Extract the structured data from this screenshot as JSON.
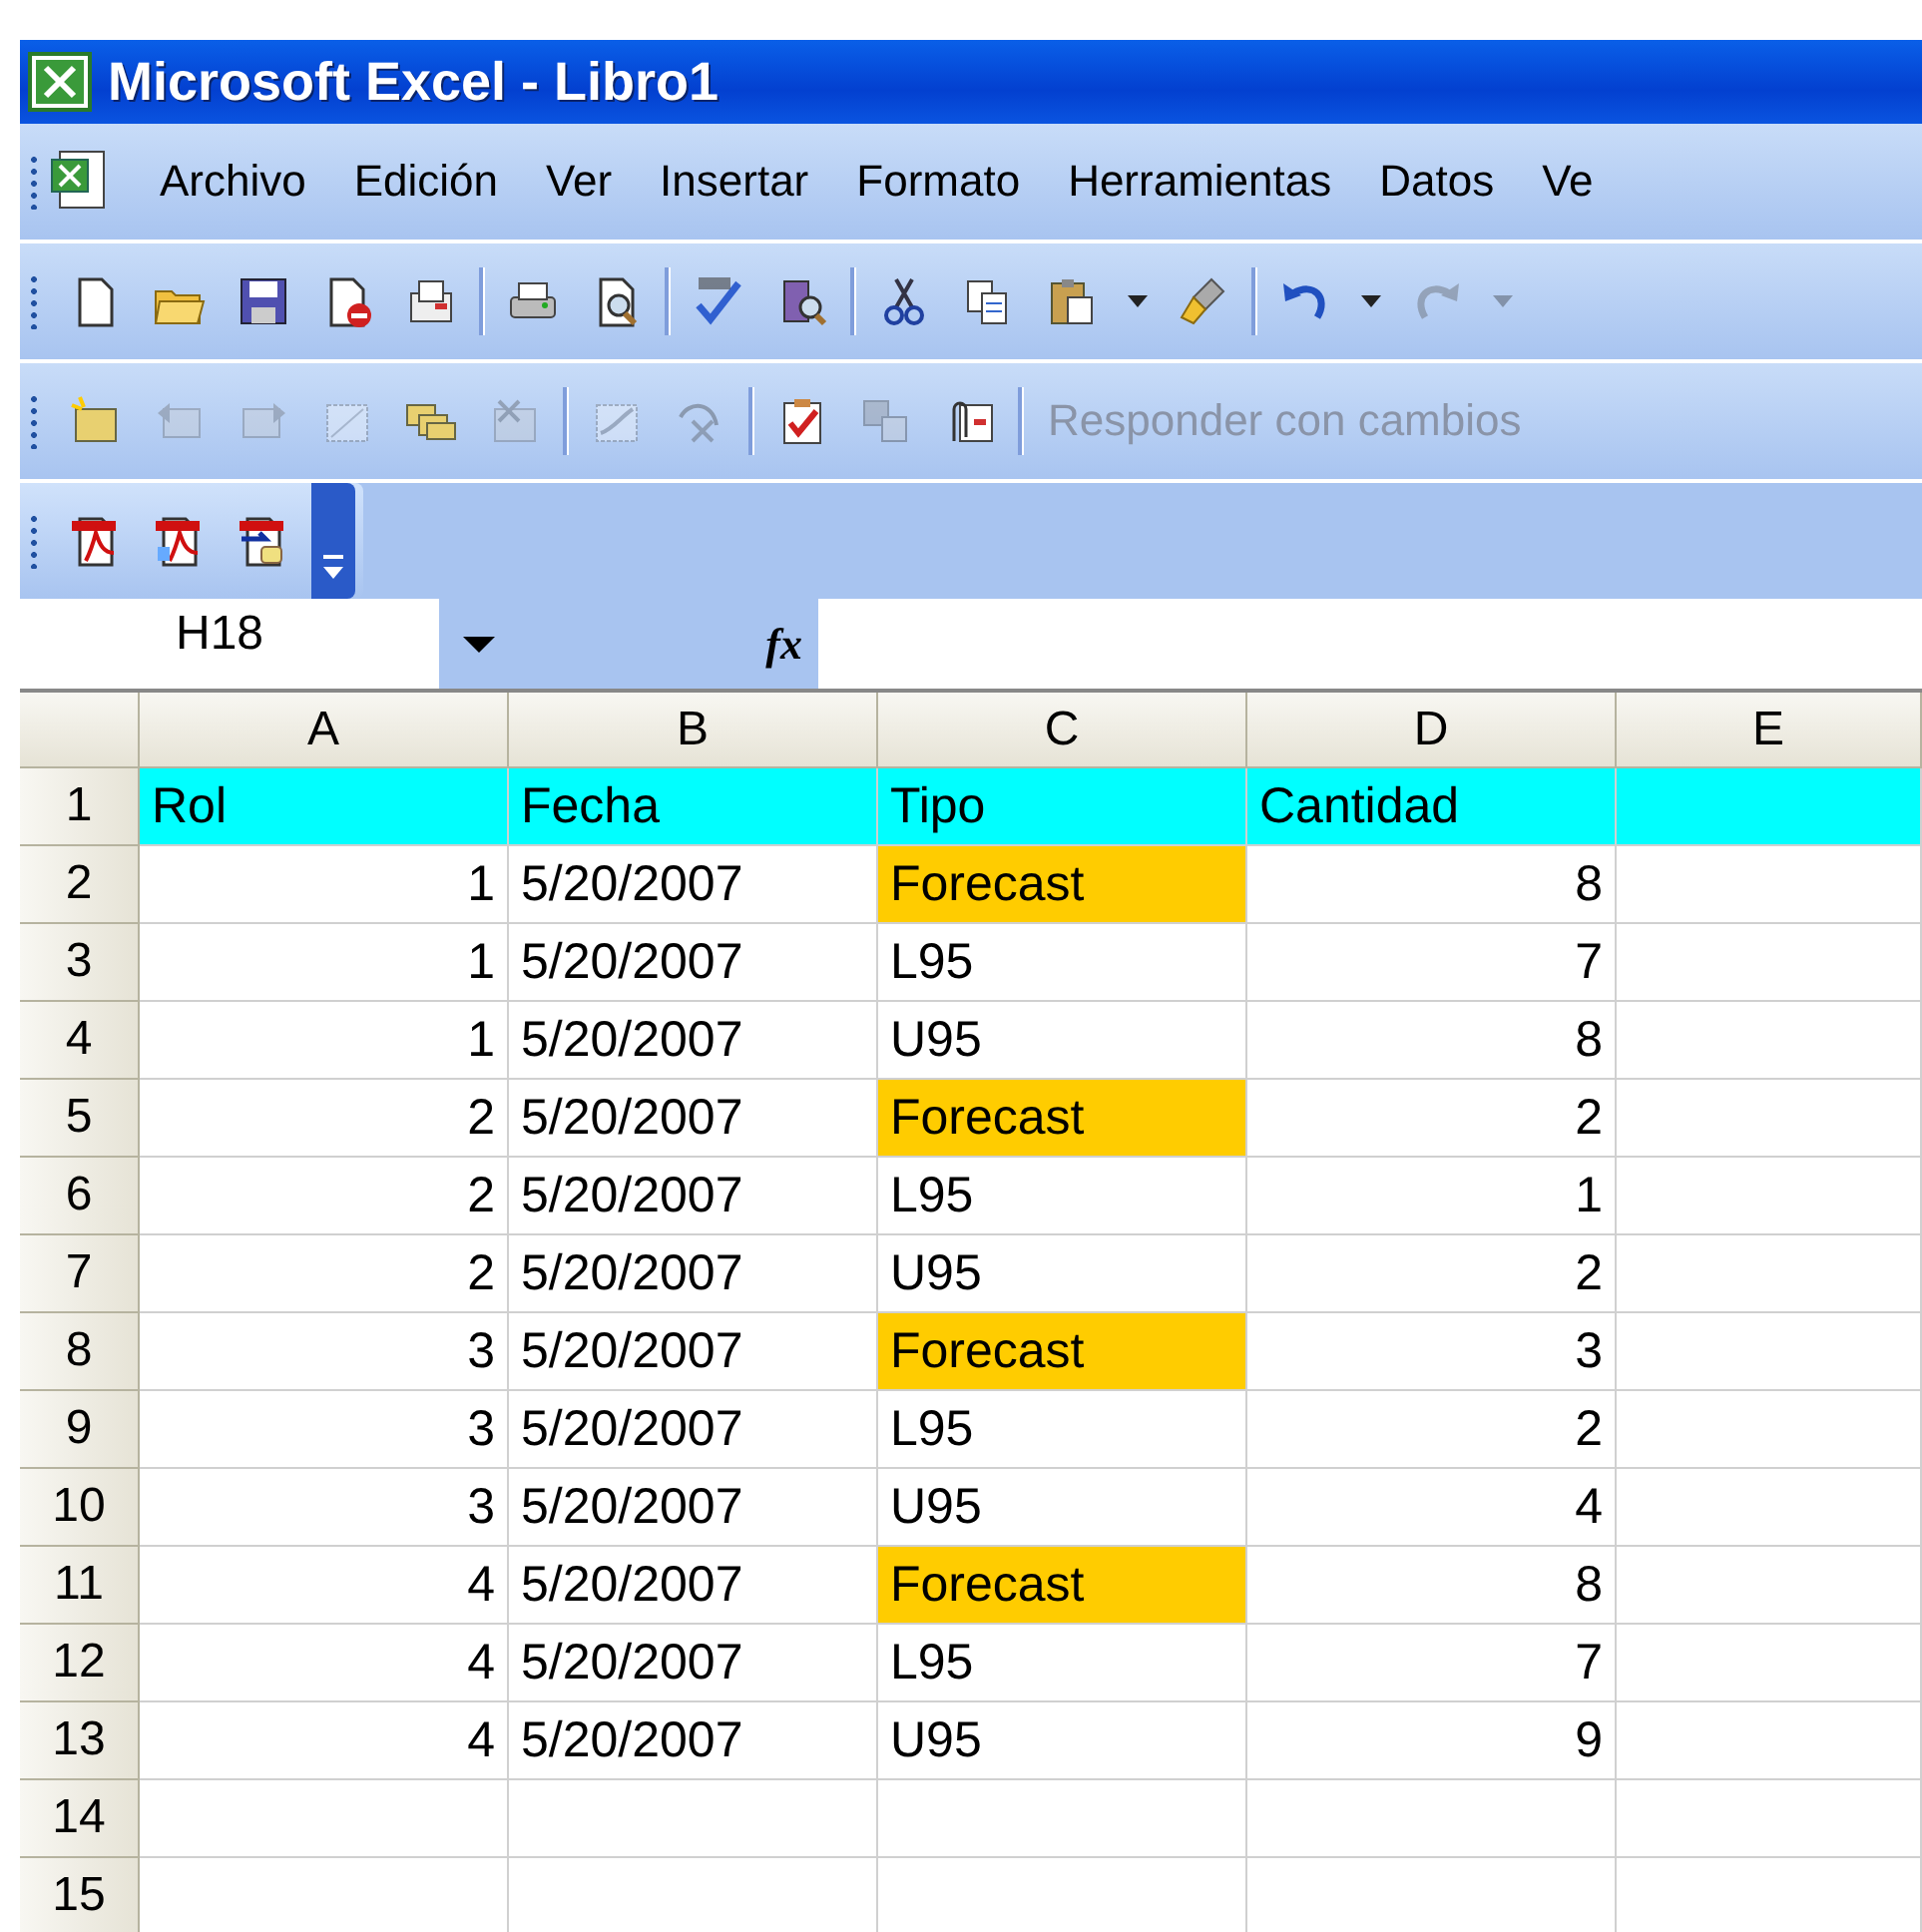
{
  "window": {
    "title": "Microsoft Excel - Libro1"
  },
  "menu": {
    "items": [
      "Archivo",
      "Edición",
      "Ver",
      "Insertar",
      "Formato",
      "Herramientas",
      "Datos",
      "Ve"
    ]
  },
  "toolbars": [
    {
      "items": [
        {
          "kind": "button",
          "disabled": false
        },
        {
          "kind": "button",
          "disabled": false
        },
        {
          "kind": "button",
          "disabled": false
        },
        {
          "kind": "button",
          "disabled": false
        },
        {
          "kind": "button",
          "disabled": false
        },
        {
          "kind": "separator"
        },
        {
          "kind": "button",
          "disabled": false
        },
        {
          "kind": "button",
          "disabled": false
        },
        {
          "kind": "separator"
        },
        {
          "kind": "button",
          "disabled": false
        },
        {
          "kind": "button",
          "disabled": false
        },
        {
          "kind": "separator"
        },
        {
          "kind": "button",
          "disabled": false
        },
        {
          "kind": "button",
          "disabled": false
        },
        {
          "kind": "button",
          "disabled": false
        },
        {
          "kind": "dropdown",
          "disabled": false
        },
        {
          "kind": "button",
          "disabled": false
        },
        {
          "kind": "separator"
        },
        {
          "kind": "button",
          "disabled": false
        },
        {
          "kind": "dropdown",
          "disabled": false
        },
        {
          "kind": "button",
          "disabled": true
        },
        {
          "kind": "dropdown",
          "disabled": true
        }
      ]
    },
    {
      "items": [
        {
          "kind": "button",
          "disabled": false
        },
        {
          "kind": "button",
          "disabled": true
        },
        {
          "kind": "button",
          "disabled": true
        },
        {
          "kind": "button",
          "disabled": true
        },
        {
          "kind": "button",
          "disabled": false
        },
        {
          "kind": "button",
          "disabled": true
        },
        {
          "kind": "separator"
        },
        {
          "kind": "button",
          "disabled": true
        },
        {
          "kind": "button",
          "disabled": true
        },
        {
          "kind": "separator"
        },
        {
          "kind": "button",
          "disabled": false
        },
        {
          "kind": "button",
          "disabled": true
        },
        {
          "kind": "button",
          "disabled": false
        },
        {
          "kind": "separator"
        },
        {
          "kind": "text",
          "label": "Responder con cambios",
          "disabled": true
        }
      ]
    },
    {
      "items": [
        {
          "kind": "button",
          "disabled": false
        },
        {
          "kind": "button",
          "disabled": false
        },
        {
          "kind": "button",
          "disabled": false
        }
      ]
    }
  ],
  "formula_bar": {
    "name_box": "H18",
    "fx": "fx"
  },
  "sheet": {
    "columns": [
      "A",
      "B",
      "C",
      "D",
      "E"
    ],
    "rows": [
      {
        "number": "1",
        "color": "#00ffff",
        "cells": [
          {
            "text": "Rol",
            "kind": "text"
          },
          {
            "text": "Fecha",
            "kind": "text"
          },
          {
            "text": "Tipo",
            "kind": "text"
          },
          {
            "text": "Cantidad",
            "kind": "text"
          }
        ]
      },
      {
        "number": "2",
        "cells": [
          {
            "text": "1",
            "kind": "number"
          },
          {
            "text": "5/20/2007",
            "kind": "text"
          },
          {
            "text": "Forecast",
            "kind": "text",
            "color": "#ffcc00"
          },
          {
            "text": "8",
            "kind": "number"
          }
        ]
      },
      {
        "number": "3",
        "cells": [
          {
            "text": "1",
            "kind": "number"
          },
          {
            "text": "5/20/2007",
            "kind": "text"
          },
          {
            "text": "L95",
            "kind": "text"
          },
          {
            "text": "7",
            "kind": "number"
          }
        ]
      },
      {
        "number": "4",
        "cells": [
          {
            "text": "1",
            "kind": "number"
          },
          {
            "text": "5/20/2007",
            "kind": "text"
          },
          {
            "text": "U95",
            "kind": "text"
          },
          {
            "text": "8",
            "kind": "number"
          }
        ]
      },
      {
        "number": "5",
        "cells": [
          {
            "text": "2",
            "kind": "number"
          },
          {
            "text": "5/20/2007",
            "kind": "text"
          },
          {
            "text": "Forecast",
            "kind": "text",
            "color": "#ffcc00"
          },
          {
            "text": "2",
            "kind": "number"
          }
        ]
      },
      {
        "number": "6",
        "cells": [
          {
            "text": "2",
            "kind": "number"
          },
          {
            "text": "5/20/2007",
            "kind": "text"
          },
          {
            "text": "L95",
            "kind": "text"
          },
          {
            "text": "1",
            "kind": "number"
          }
        ]
      },
      {
        "number": "7",
        "cells": [
          {
            "text": "2",
            "kind": "number"
          },
          {
            "text": "5/20/2007",
            "kind": "text"
          },
          {
            "text": "U95",
            "kind": "text"
          },
          {
            "text": "2",
            "kind": "number"
          }
        ]
      },
      {
        "number": "8",
        "cells": [
          {
            "text": "3",
            "kind": "number"
          },
          {
            "text": "5/20/2007",
            "kind": "text"
          },
          {
            "text": "Forecast",
            "kind": "text",
            "color": "#ffcc00"
          },
          {
            "text": "3",
            "kind": "number"
          }
        ]
      },
      {
        "number": "9",
        "cells": [
          {
            "text": "3",
            "kind": "number"
          },
          {
            "text": "5/20/2007",
            "kind": "text"
          },
          {
            "text": "L95",
            "kind": "text"
          },
          {
            "text": "2",
            "kind": "number"
          }
        ]
      },
      {
        "number": "10",
        "cells": [
          {
            "text": "3",
            "kind": "number"
          },
          {
            "text": "5/20/2007",
            "kind": "text"
          },
          {
            "text": "U95",
            "kind": "text"
          },
          {
            "text": "4",
            "kind": "number"
          }
        ]
      },
      {
        "number": "11",
        "cells": [
          {
            "text": "4",
            "kind": "number"
          },
          {
            "text": "5/20/2007",
            "kind": "text"
          },
          {
            "text": "Forecast",
            "kind": "text",
            "color": "#ffcc00"
          },
          {
            "text": "8",
            "kind": "number"
          }
        ]
      },
      {
        "number": "12",
        "cells": [
          {
            "text": "4",
            "kind": "number"
          },
          {
            "text": "5/20/2007",
            "kind": "text"
          },
          {
            "text": "L95",
            "kind": "text"
          },
          {
            "text": "7",
            "kind": "number"
          }
        ]
      },
      {
        "number": "13",
        "cells": [
          {
            "text": "4",
            "kind": "number"
          },
          {
            "text": "5/20/2007",
            "kind": "text"
          },
          {
            "text": "U95",
            "kind": "text"
          },
          {
            "text": "9",
            "kind": "number"
          }
        ]
      },
      {
        "number": "14"
      },
      {
        "number": "15"
      }
    ]
  }
}
